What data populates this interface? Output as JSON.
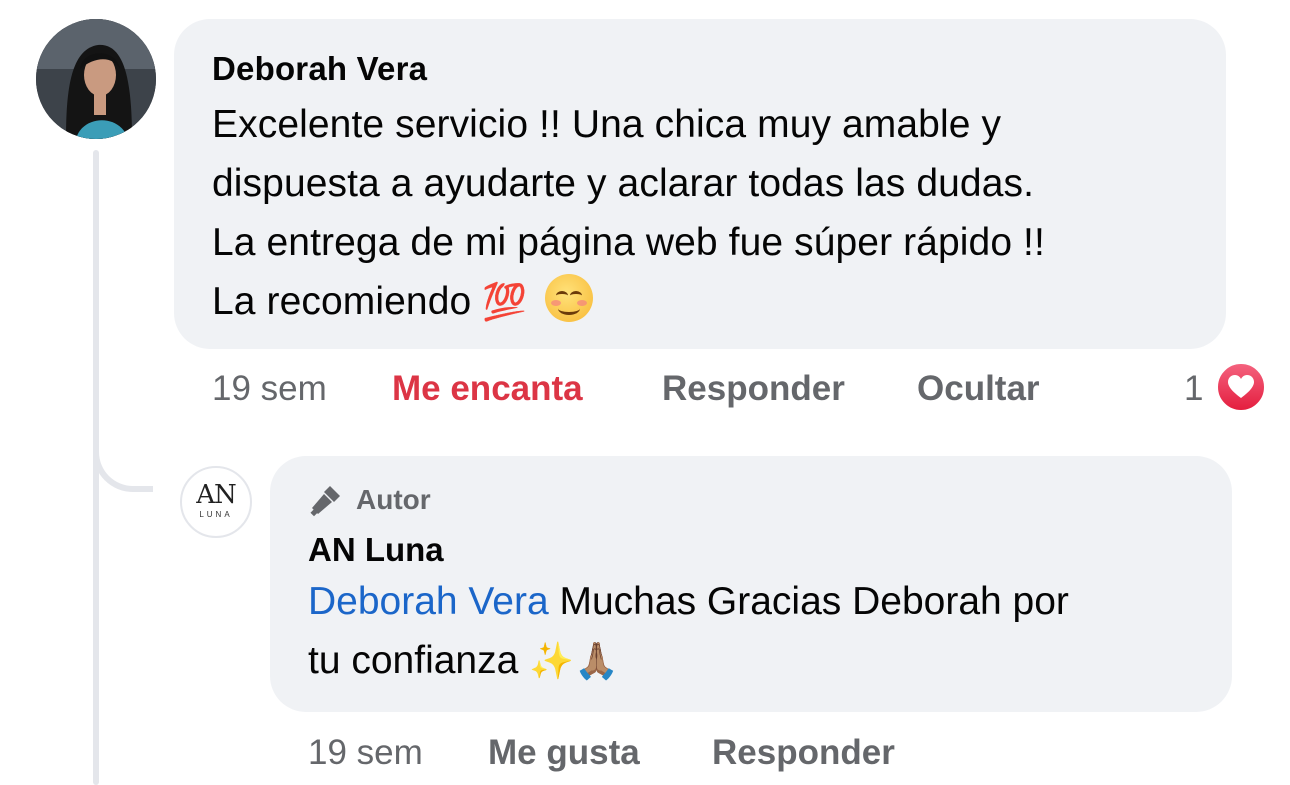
{
  "comment": {
    "author": "Deborah Vera",
    "text_lines": [
      "Excelente servicio !! Una chica muy amable y",
      "dispuesta a ayudarte y aclarar todas las dudas.",
      "La entrega de mi página web fue súper rápido !!",
      "La recomiendo"
    ],
    "emoji_100": "💯",
    "emoji_smile": "smiling-face-icon",
    "time": "19 sem",
    "reaction_label": "Me encanta",
    "reply_label": "Responder",
    "hide_label": "Ocultar",
    "reaction_count": "1",
    "reaction_icon": "heart-icon"
  },
  "reply": {
    "badge": "Autor",
    "badge_icon": "microphone-icon",
    "author": "AN Luna",
    "mention": "Deborah Vera",
    "text_line1": " Muchas Gracias Deborah por",
    "text_line2": "tu confianza",
    "emoji_sparkles": "✨",
    "emoji_pray": "🙏🏽",
    "logo_text": "AN",
    "logo_sub": "LUNA",
    "time": "19 sem",
    "like_label": "Me gusta",
    "reply_label": "Responder"
  },
  "colors": {
    "accent_love": "#dc3545",
    "mention": "#1b66c9",
    "bubble": "#f0f2f5",
    "muted": "#65676b"
  }
}
